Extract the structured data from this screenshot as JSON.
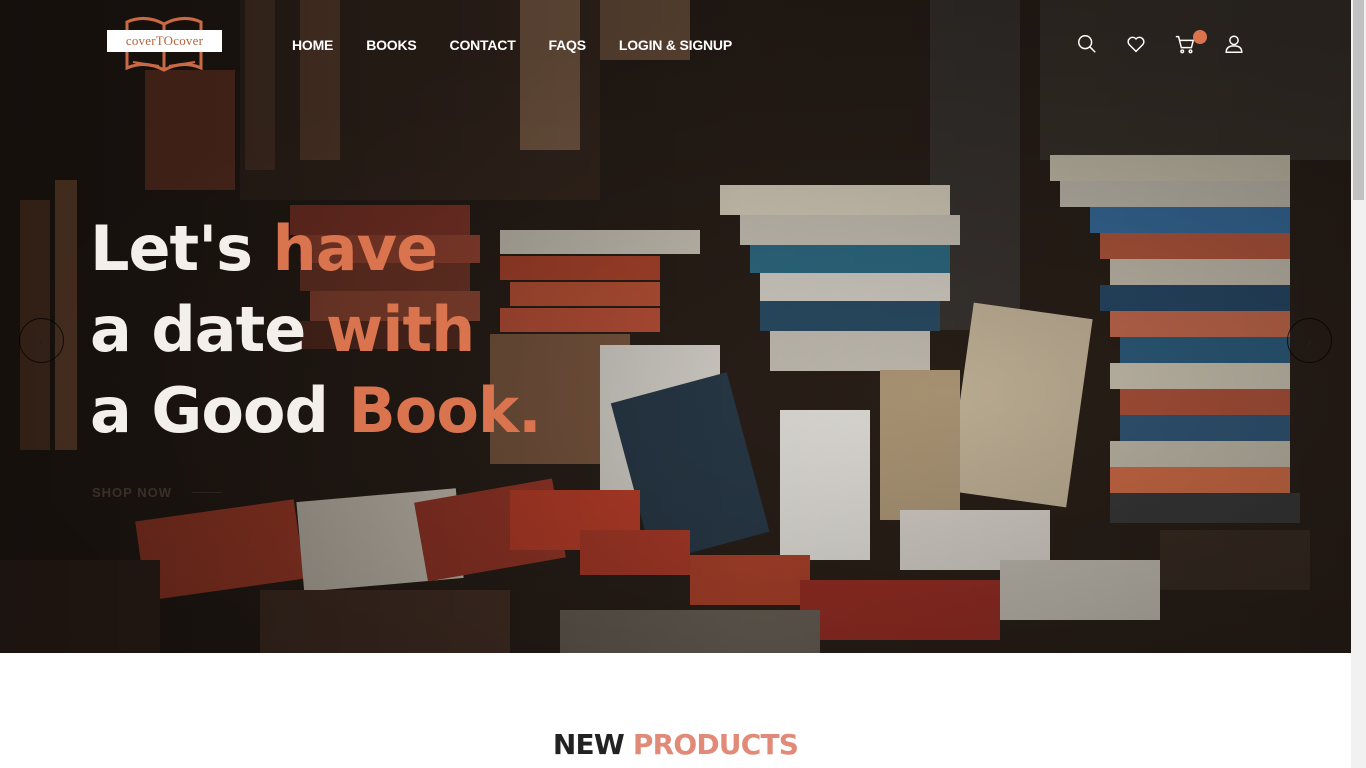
{
  "brand": {
    "logo_text": "coverTOcover",
    "logo_icon": "open-book-icon"
  },
  "nav": {
    "items": [
      "HOME",
      "BOOKS",
      "CONTACT",
      "FAQS",
      "LOGIN & SIGNUP"
    ]
  },
  "header_icons": [
    "search-icon",
    "heart-icon",
    "cart-icon",
    "user-icon"
  ],
  "hero": {
    "line1": {
      "plain": "Let's ",
      "accent": "have"
    },
    "line2": {
      "plain": "a date ",
      "accent": "with"
    },
    "line3": {
      "plain": "a Good ",
      "accent": "Book."
    },
    "cta": "SHOP NOW",
    "prev_icon": "chevron-left-icon",
    "next_icon": "chevron-right-icon",
    "prev_glyph": "‹",
    "next_glyph": "›"
  },
  "section": {
    "title_plain": "NEW ",
    "title_accent": "PRODUCTS"
  },
  "colors": {
    "accent": "#d9744f",
    "accent_light": "#e08a77",
    "text_dark": "#222222"
  }
}
